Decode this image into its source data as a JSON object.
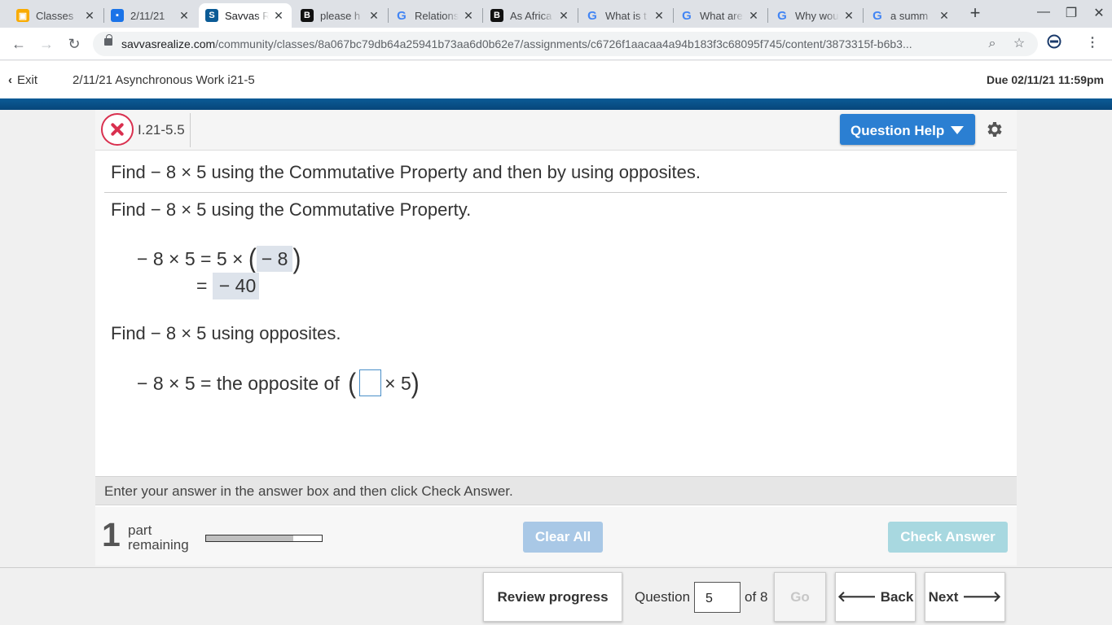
{
  "browser": {
    "tabs": [
      {
        "label": "Classes",
        "favicon": "classroom-icon",
        "color": "#f9ab00"
      },
      {
        "label": "2/11/21",
        "favicon": "classroom-assignment-icon",
        "color": "#1a73e8"
      },
      {
        "label": "Savvas R",
        "favicon": "savvas-icon",
        "color": "#0b5b96"
      },
      {
        "label": "please h",
        "favicon": "brainly-icon",
        "color": "#111111"
      },
      {
        "label": "Relations",
        "favicon": "google-icon",
        "color": "#4285f4"
      },
      {
        "label": "As Africa",
        "favicon": "brainly-icon",
        "color": "#111111"
      },
      {
        "label": "What is t",
        "favicon": "google-icon",
        "color": "#4285f4"
      },
      {
        "label": "What are",
        "favicon": "google-icon",
        "color": "#4285f4"
      },
      {
        "label": "Why wou",
        "favicon": "google-icon",
        "color": "#4285f4"
      },
      {
        "label": "a summ",
        "favicon": "google-icon",
        "color": "#4285f4"
      }
    ],
    "url_domain": "savvasrealize.com",
    "url_path": "/community/classes/8a067bc79db64a25941b73aa6d0b62e7/assignments/c6726f1aacaa4a94b183f3c68095f745/content/3873315f-b6b3..."
  },
  "header": {
    "exit_label": "Exit",
    "assignment_title": "2/11/21 Asynchronous Work i21-5",
    "due": "Due 02/11/21 11:59pm"
  },
  "question": {
    "id": "I.21-5.5",
    "help_label": "Question Help",
    "prompt": "Find  − 8 × 5 using the Commutative Property and then by using opposites.",
    "part1_prompt": "Find  − 8 × 5 using the Commutative Property.",
    "eq1_lhs": "− 8 × 5 = 5 ×",
    "eq1_answer": "− 8",
    "eq2_lhs": "=",
    "eq2_answer": "− 40",
    "part2_prompt": "Find  − 8 × 5 using opposites.",
    "eq3_lhs": "− 8 × 5 = the opposite of",
    "eq3_tail": "× 5"
  },
  "instructions": "Enter your answer in the answer box and then click Check Answer.",
  "footer": {
    "parts_remaining": "1",
    "part_label_1": "part",
    "part_label_2": "remaining",
    "progress_fraction": 0.75,
    "clear_label": "Clear All",
    "check_label": "Check Answer"
  },
  "nav": {
    "review_label": "Review progress",
    "question_label": "Question",
    "question_number": "5",
    "of_label": "of 8",
    "go_label": "Go",
    "back_label": "Back",
    "next_label": "Next"
  }
}
